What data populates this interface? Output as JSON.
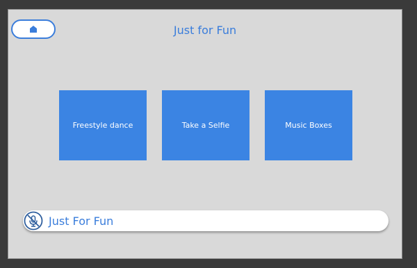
{
  "header": {
    "title": "Just for Fun",
    "home_icon": "home-icon"
  },
  "tiles": [
    {
      "label": "Freestyle dance"
    },
    {
      "label": "Take a Selfie"
    },
    {
      "label": "Music Boxes"
    }
  ],
  "footer": {
    "label": "Just For Fun",
    "icon": "mic-off-icon"
  },
  "colors": {
    "accent": "#3a7ddb",
    "tile": "#3b84e3",
    "panel": "#d9d9d9",
    "background": "#3a3a3a"
  }
}
